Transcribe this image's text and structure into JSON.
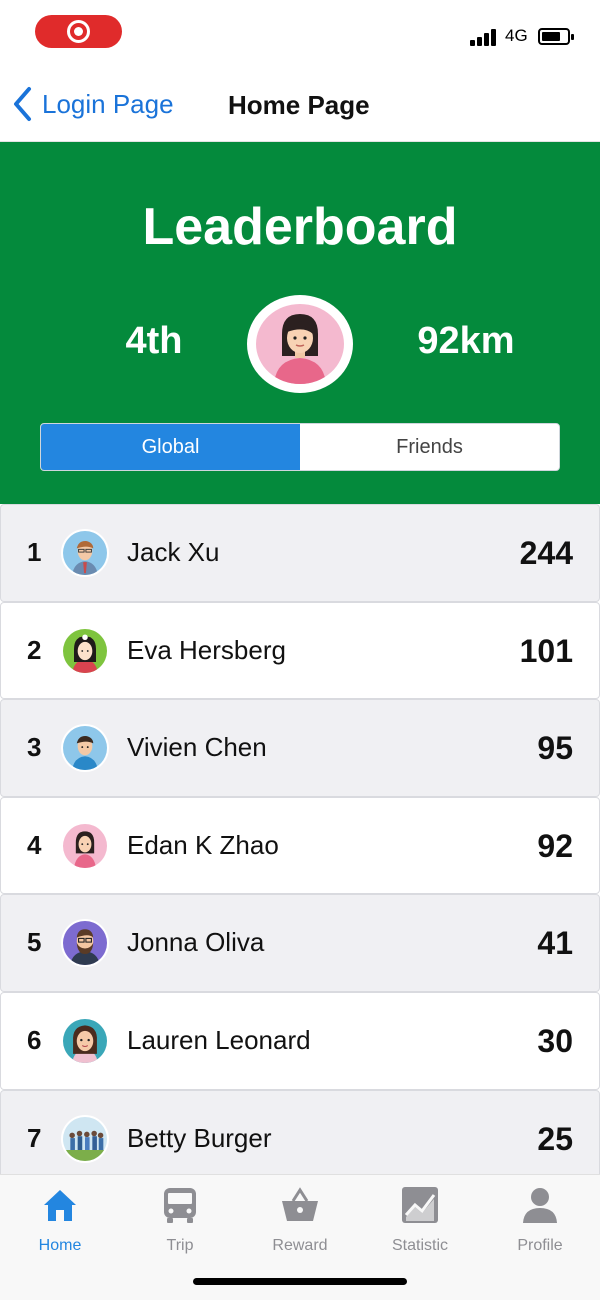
{
  "status_bar": {
    "network": "4G"
  },
  "nav": {
    "back_label": "Login Page",
    "title": "Home Page"
  },
  "header": {
    "title": "Leaderboard",
    "user_rank": "4th",
    "user_distance": "92km",
    "segments": [
      "Global",
      "Friends"
    ],
    "selected_segment": "Global",
    "color": "#048a3c"
  },
  "leaderboard": [
    {
      "rank": "1",
      "name": "Jack Xu",
      "score": "244",
      "avatar": "man-tie-avatar"
    },
    {
      "rank": "2",
      "name": "Eva Hersberg",
      "score": "101",
      "avatar": "girl-avatar"
    },
    {
      "rank": "3",
      "name": "Vivien Chen",
      "score": "95",
      "avatar": "boy-avatar"
    },
    {
      "rank": "4",
      "name": "Edan K Zhao",
      "score": "92",
      "avatar": "woman-avatar"
    },
    {
      "rank": "5",
      "name": "Jonna Oliva",
      "score": "41",
      "avatar": "bearded-man-avatar"
    },
    {
      "rank": "6",
      "name": "Lauren Leonard",
      "score": "30",
      "avatar": "cartoon-woman-avatar"
    },
    {
      "rank": "7",
      "name": "Betty Burger",
      "score": "25",
      "avatar": "group-photo-avatar"
    }
  ],
  "tabs": [
    {
      "label": "Home",
      "icon": "home-icon",
      "active": true
    },
    {
      "label": "Trip",
      "icon": "bus-icon",
      "active": false
    },
    {
      "label": "Reward",
      "icon": "basket-icon",
      "active": false
    },
    {
      "label": "Statistic",
      "icon": "chart-icon",
      "active": false
    },
    {
      "label": "Profile",
      "icon": "person-icon",
      "active": false
    }
  ],
  "colors": {
    "accent": "#2386e0",
    "link": "#1a73d9",
    "record": "#e02b2b"
  }
}
